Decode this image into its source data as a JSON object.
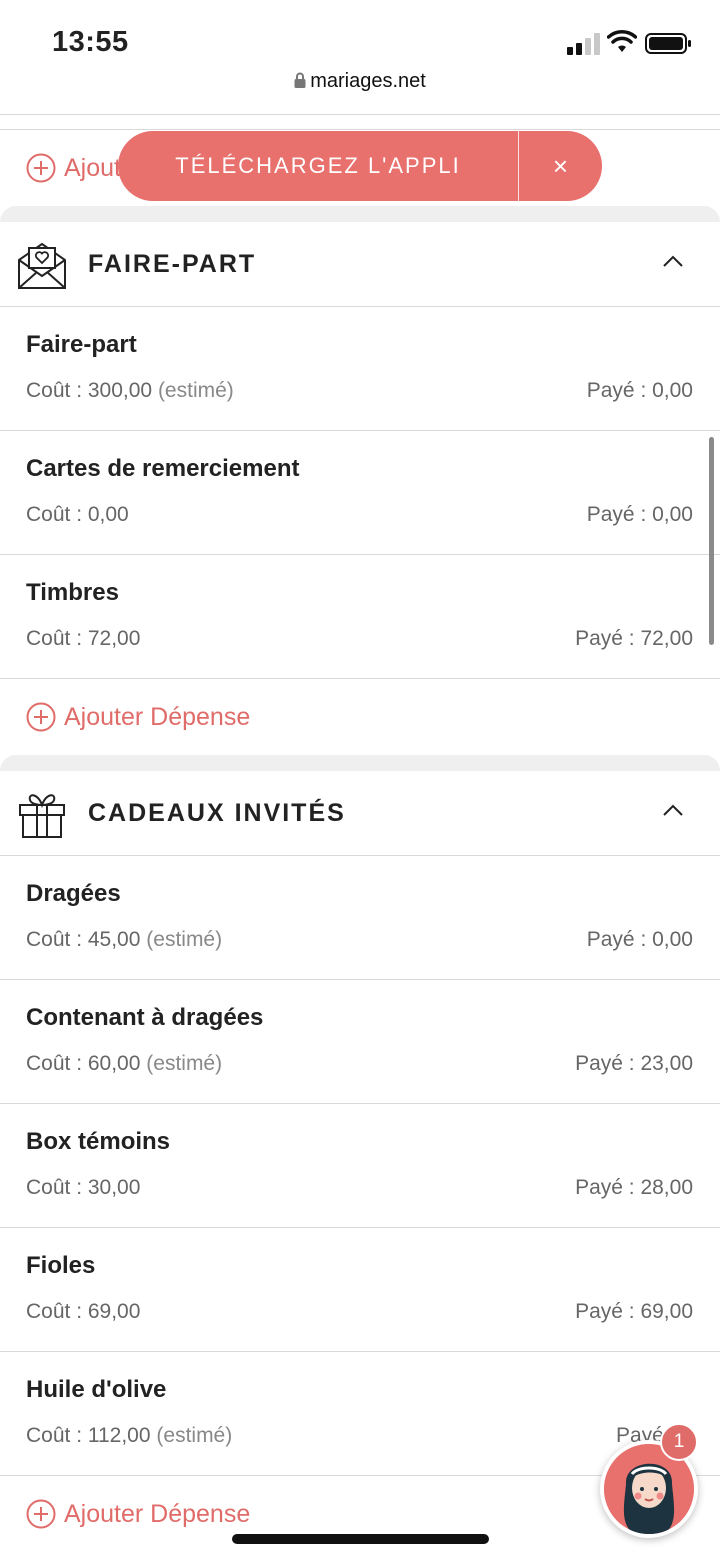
{
  "status_bar": {
    "time": "13:55"
  },
  "browser": {
    "url": "mariages.net"
  },
  "banner": {
    "label": "TÉLÉCHARGEZ L'APPLI",
    "close": "×"
  },
  "top_add": {
    "label": "Ajouter Dépense"
  },
  "sections": [
    {
      "title": "FAIRE-PART",
      "icon": "envelope-heart-icon",
      "items": [
        {
          "name": "Faire-part",
          "cost": "Coût : 300,00",
          "estimate": "(estimé)",
          "paid": "Payé : 0,00"
        },
        {
          "name": "Cartes de remerciement",
          "cost": "Coût : 0,00",
          "estimate": "",
          "paid": "Payé : 0,00"
        },
        {
          "name": "Timbres",
          "cost": "Coût : 72,00",
          "estimate": "",
          "paid": "Payé : 72,00"
        }
      ],
      "add_label": "Ajouter Dépense"
    },
    {
      "title": "CADEAUX INVITÉS",
      "icon": "gift-icon",
      "items": [
        {
          "name": "Dragées",
          "cost": "Coût : 45,00",
          "estimate": "(estimé)",
          "paid": "Payé : 0,00"
        },
        {
          "name": "Contenant à dragées",
          "cost": "Coût : 60,00",
          "estimate": "(estimé)",
          "paid": "Payé : 23,00"
        },
        {
          "name": "Box témoins",
          "cost": "Coût : 30,00",
          "estimate": "",
          "paid": "Payé : 28,00"
        },
        {
          "name": "Fioles",
          "cost": "Coût : 69,00",
          "estimate": "",
          "paid": "Payé : 69,00"
        },
        {
          "name": "Huile d'olive",
          "cost": "Coût : 112,00",
          "estimate": "(estimé)",
          "paid": "Payé : 0"
        }
      ],
      "add_label": "Ajouter Dépense"
    }
  ],
  "chat": {
    "badge": "1"
  },
  "colors": {
    "accent": "#e8706d",
    "text": "#222222",
    "muted": "#666666",
    "divider": "#d9d9d9"
  }
}
